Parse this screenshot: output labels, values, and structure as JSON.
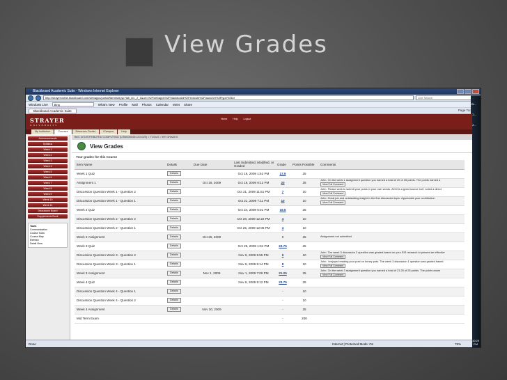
{
  "slide": {
    "title": "View Grades"
  },
  "browser": {
    "window_title": "Blackboard Academic Suite - Windows Internet Explorer",
    "address": "http://strayeronline.blackboard.com/webapps/portal/frameset.jsp?tab_id=_2_1&url=%2Fwebapps%2Fblackboard%2Fexecute%2Flauncher%3Ftype%3Dd",
    "search_placeholder": "Live Search",
    "links": [
      "Windows Live",
      "Bing",
      "What's New",
      "Profile",
      "Mail",
      "Photos",
      "Calendar",
      "MSN",
      "Share"
    ],
    "user": "John",
    "tab_label": "Blackboard Academic Suite",
    "tools_label": "Page  Tools",
    "status": "Done",
    "zone": "Internet | Protected Mode: On",
    "zoom": "75%"
  },
  "taskbar": {
    "items": [
      "Bl...",
      "Cl...",
      "M..."
    ],
    "clock": "10:29 PM"
  },
  "site": {
    "logo": "STRAYER",
    "logo_sub": "UNIVERSITY",
    "banner_links": [
      "Home",
      "Help",
      "Logout"
    ],
    "tabs": [
      "My Institution",
      "Courses",
      "Resource Center",
      "iCampus",
      "Help"
    ],
    "nav": [
      "Announcements",
      "Syllabus",
      "Week 1",
      "Week 2",
      "Week 3",
      "Week 4",
      "Week 5",
      "Week 6",
      "Week 7",
      "Week 8",
      "Week 9",
      "Week 10",
      "Week 11",
      "Discussion Board",
      "Supplements Book"
    ],
    "tools_title": "Tools",
    "tools": [
      "Communication",
      "Course Tools",
      "Course Map",
      "Refresh",
      "Detail View"
    ],
    "breadcrumb": "BEC 40 DISTRIBUTED COMPUTING (CIS60050434 201020) > TOOLS > MY GRADES",
    "page_title": "View Grades",
    "subtitle": "Your grades for this Course"
  },
  "grades": {
    "headers": [
      "Item Name",
      "Details",
      "Due Date",
      "Last Submitted, Modified, or Graded",
      "Grade",
      "Points Possible",
      "Comments"
    ],
    "details_label": "Details",
    "view_comment_label": "View Full Comment",
    "rows": [
      {
        "name": "Week 1 Quiz",
        "due": "",
        "last": "Oct 19, 2009 1:52 PM",
        "grade": "17.9",
        "possible": "25",
        "comment": ""
      },
      {
        "name": "Assignment 1",
        "due": "Oct 18, 2009",
        "last": "Oct 18, 2009 9:12 PM",
        "grade": "20",
        "possible": "25",
        "comment": "John. On the week 1 assignment question you earned a total of 20 of 25 points. The points earned a"
      },
      {
        "name": "Discussion Question Week 1 - Question 2",
        "due": "",
        "last": "Oct 21, 2009 11:51 PM",
        "grade": "7",
        "possible": "10",
        "comment": "John. Please work to submit your posts in your own words. ACM is a great source but I noted a direct"
      },
      {
        "name": "Discussion Question Week 1 - Question 1",
        "due": "",
        "last": "Oct 21, 2009 7:11 PM",
        "grade": "10",
        "possible": "10",
        "comment": "John. Great job and outstanding insight in the first discussion topic. Appreciate your contribution"
      },
      {
        "name": "Week 2 Quiz",
        "due": "",
        "last": "Oct 24, 2009 6:01 PM",
        "grade": "19.5",
        "possible": "25",
        "comment": ""
      },
      {
        "name": "Discussion Question Week 2 - Question 2",
        "due": "",
        "last": "Oct 28, 2009 12:22 PM",
        "grade": "4",
        "possible": "10",
        "comment": ""
      },
      {
        "name": "Discussion Question Week 2 - Question 1",
        "due": "",
        "last": "Oct 25, 2009 12:05 PM",
        "grade": "4",
        "possible": "10",
        "comment": ""
      },
      {
        "name": "Week 2 Assignment",
        "due": "Oct 25, 2009",
        "last": "",
        "grade": "0",
        "possible": "25",
        "comment": "Assignment not submitted"
      },
      {
        "name": "Week 3 Quiz",
        "due": "",
        "last": "Oct 29, 2009 1:04 PM",
        "grade": "23.75",
        "possible": "25",
        "comment": ""
      },
      {
        "name": "Discussion Question Week 3 - Question 2",
        "due": "",
        "last": "Nov 6, 2009 5:55 PM",
        "grade": "9",
        "possible": "10",
        "comment": "John. The week 3 discussion 2 question was graded based on your EIS research to present an effective"
      },
      {
        "name": "Discussion Question Week 3 - Question 1",
        "due": "",
        "last": "Nov 6, 2009 5:14 PM",
        "grade": "8",
        "possible": "10",
        "comment": "John. I enjoyed reading your post on honey pots. The week 3 discussion 1 question was graded based"
      },
      {
        "name": "Week 3 Assignment",
        "due": "Nov 1, 2009",
        "last": "Nov 1, 2009 7:06 PM",
        "grade": "21.25",
        "possible": "25",
        "comment": "John. On the week 3 assignment question you earned a total of 21.25 of 25 points. The points earne"
      },
      {
        "name": "Week 4 Quiz",
        "due": "",
        "last": "Nov 6, 2009 9:12 PM",
        "grade": "23.75",
        "possible": "25",
        "comment": ""
      },
      {
        "name": "Discussion Question Week 4 - Question 1",
        "due": "",
        "last": "",
        "grade": "-",
        "possible": "10",
        "comment": ""
      },
      {
        "name": "Discussion Question Week 4 - Question 2",
        "due": "",
        "last": "",
        "grade": "-",
        "possible": "10",
        "comment": ""
      },
      {
        "name": "Week 4 Assignment",
        "due": "Nov 30, 2009",
        "last": "",
        "grade": "-",
        "possible": "25",
        "comment": ""
      },
      {
        "name": "Mid Term Exam",
        "due": "",
        "last": "",
        "grade": "-",
        "possible": "200",
        "comment": ""
      }
    ]
  }
}
